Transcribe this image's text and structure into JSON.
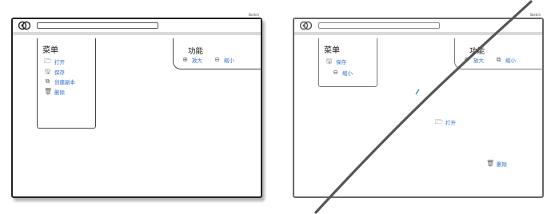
{
  "left_panel": {
    "window_title": "Sketch",
    "menu": {
      "title": "菜单",
      "items": [
        {
          "label": "打开",
          "icon": "folder-open-icon",
          "glyph": "🗁"
        },
        {
          "label": "保存",
          "icon": "save-icon",
          "glyph": "🖫"
        },
        {
          "label": "创建副本",
          "icon": "copy-icon",
          "glyph": "⧉"
        },
        {
          "label": "删除",
          "icon": "trash-icon",
          "glyph": "🗑"
        }
      ]
    },
    "functions": {
      "title": "功能",
      "items": [
        {
          "label": "放大",
          "icon": "zoom-in-icon",
          "glyph": "⊕"
        },
        {
          "label": "缩小",
          "icon": "zoom-out-icon",
          "glyph": "⊖"
        }
      ]
    }
  },
  "right_panel": {
    "window_title": "Sketch",
    "menu": {
      "title": "菜单",
      "items": [
        {
          "label": "保存",
          "icon": "save-icon",
          "glyph": "🖫"
        },
        {
          "label": "缩小",
          "icon": "zoom-out-icon",
          "glyph": "⊖"
        }
      ]
    },
    "functions": {
      "title": "功能",
      "items": [
        {
          "label": "放大",
          "icon": "zoom-in-icon",
          "glyph": "⊕"
        },
        {
          "label": "缩小",
          "icon": "copy-icon",
          "glyph": "⧉"
        }
      ]
    },
    "floating": [
      {
        "label": "打开",
        "icon": "folder-open-icon",
        "glyph": "🗁"
      },
      {
        "label": "删除",
        "icon": "trash-icon",
        "glyph": "🗑"
      }
    ]
  },
  "colors": {
    "link": "#2e6fd4",
    "ink": "#222222",
    "strike": "#555555"
  }
}
